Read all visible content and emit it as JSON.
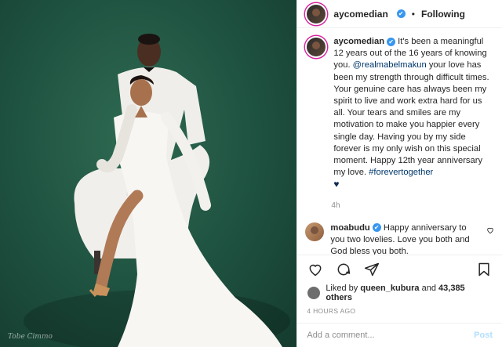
{
  "photo": {
    "watermark": "Tobe Cimmo"
  },
  "header": {
    "username": "aycomedian",
    "verified_mark": "✔",
    "separator": "•",
    "follow_status": "Following"
  },
  "caption": {
    "username": "aycomedian",
    "text_before": " It's been a meaningful 12 years out of the 16 years of knowing you. ",
    "mention": "@realmabelmakun",
    "text_middle": " your love has been my strength through difficult times. Your genuine care has always been my spirit to live and work extra hard for us all. Your tears and smiles are my motivation to make you happier every single day. Having you by my side forever is my only wish on this special moment. Happy 12th year anniversary my love. ",
    "hashtag": "#forevertogether",
    "emoji": "♥",
    "time": "4h"
  },
  "comments": [
    {
      "username": "moabudu",
      "text": " Happy anniversary to you two lovelies. Love you both and God bless you both."
    }
  ],
  "actions": {
    "icons": [
      "heart-icon",
      "comment-icon",
      "share-icon",
      "bookmark-icon"
    ]
  },
  "likes": {
    "prefix": "Liked by",
    "user": "queen_kubura",
    "and": "and",
    "others": "43,385 others"
  },
  "posted": "4 HOURS AGO",
  "add_comment": {
    "placeholder": "Add a comment...",
    "post_label": "Post"
  },
  "colors": {
    "link": "#00376b",
    "verified": "#3897f0",
    "post_disabled": "#b2dffc",
    "photo_bg": "#1e5140"
  }
}
